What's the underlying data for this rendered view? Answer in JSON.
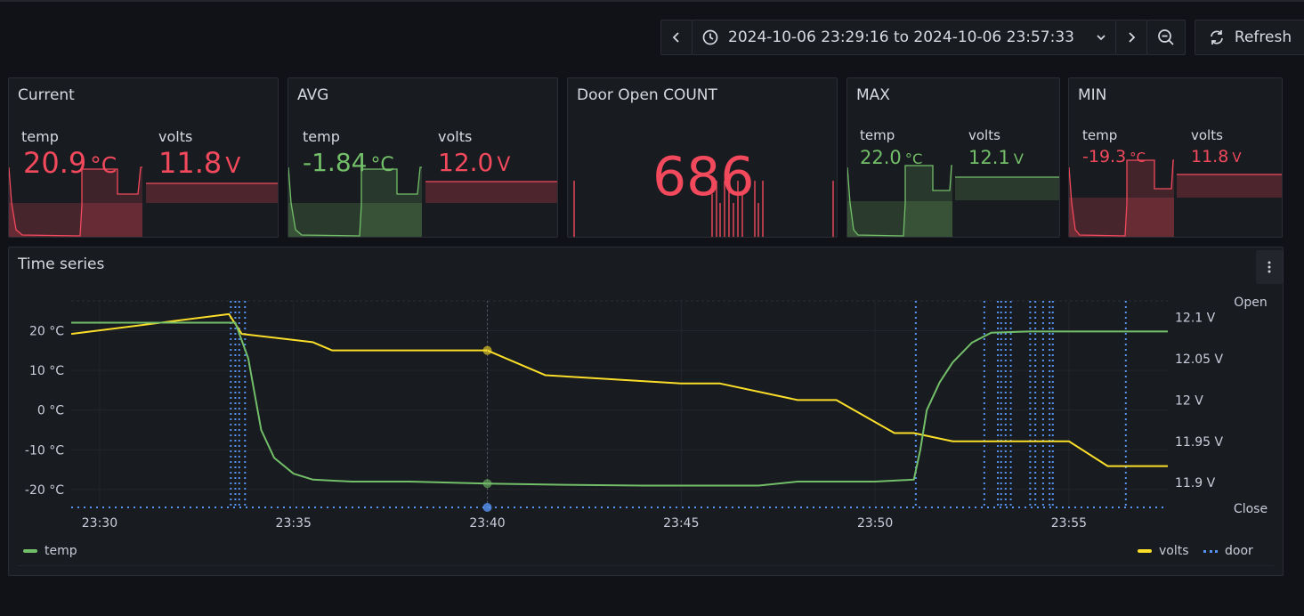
{
  "toolbar": {
    "time_range": "2024-10-06 23:29:16 to 2024-10-06 23:57:33",
    "refresh_label": "Refresh"
  },
  "stats": {
    "current": {
      "title": "Current",
      "temp_label": "temp",
      "temp_value": "20.9",
      "temp_unit": "°C",
      "volts_label": "volts",
      "volts_value": "11.8",
      "volts_unit": "V"
    },
    "avg": {
      "title": "AVG",
      "temp_label": "temp",
      "temp_value": "-1.84",
      "temp_unit": "°C",
      "volts_label": "volts",
      "volts_value": "12.0",
      "volts_unit": "V"
    },
    "door": {
      "title": "Door Open COUNT",
      "value": "686"
    },
    "max": {
      "title": "MAX",
      "temp_label": "temp",
      "temp_value": "22.0",
      "temp_unit": "°C",
      "volts_label": "volts",
      "volts_value": "12.1",
      "volts_unit": "V"
    },
    "min": {
      "title": "MIN",
      "temp_label": "temp",
      "temp_value": "-19.3",
      "temp_unit": "°C",
      "volts_label": "volts",
      "volts_value": "11.8",
      "volts_unit": "V"
    }
  },
  "colors": {
    "red": "#f2495c",
    "green": "#73bf69",
    "yellow": "#fade2a",
    "blue": "#5794f2"
  },
  "timeseries": {
    "title": "Time series",
    "legend": {
      "temp": "temp",
      "volts": "volts",
      "door": "door"
    }
  },
  "chart_data": {
    "type": "line",
    "title": "Time series",
    "x_ticks": [
      "23:30",
      "23:35",
      "23:40",
      "23:45",
      "23:50",
      "23:55"
    ],
    "xlim": [
      "23:29:16",
      "23:57:33"
    ],
    "y_left_ticks": [
      "20 °C",
      "10 °C",
      "0 °C",
      "-10 °C",
      "-20 °C"
    ],
    "y_left_range": [
      -24.5,
      27.5
    ],
    "y_right_ticks": [
      "12.1 V",
      "12.05 V",
      "12 V",
      "11.95 V",
      "11.9 V"
    ],
    "y_right_range": [
      11.87,
      12.12
    ],
    "door_labels": {
      "open": "Open",
      "close": "Close"
    },
    "series": [
      {
        "name": "temp",
        "axis": "left",
        "color": "#73bf69",
        "x": [
          "23:29:16",
          "23:33:30",
          "23:33:50",
          "23:34:10",
          "23:34:30",
          "23:35:00",
          "23:35:30",
          "23:36:30",
          "23:38:00",
          "23:40:00",
          "23:42:00",
          "23:44:00",
          "23:46:00",
          "23:47:00",
          "23:48:00",
          "23:49:00",
          "23:50:00",
          "23:51:00",
          "23:51:10",
          "23:51:20",
          "23:51:40",
          "23:52:00",
          "23:52:30",
          "23:53:00",
          "23:54:00",
          "23:55:00",
          "23:56:00",
          "23:57:33"
        ],
        "values": [
          22,
          22,
          13,
          -5,
          -12,
          -16,
          -17.5,
          -18,
          -18,
          -18.5,
          -18.8,
          -19,
          -19,
          -19,
          -18,
          -18,
          -18,
          -17.5,
          -10,
          0,
          7,
          12,
          17,
          19.5,
          19.8,
          19.8,
          19.8,
          19.8
        ]
      },
      {
        "name": "volts",
        "axis": "right",
        "color": "#fade2a",
        "x": [
          "23:29:16",
          "23:33:20",
          "23:33:40",
          "23:35:30",
          "23:36:00",
          "23:40:00",
          "23:41:30",
          "23:45:00",
          "23:46:00",
          "23:48:00",
          "23:49:00",
          "23:50:30",
          "23:51:00",
          "23:52:00",
          "23:53:00",
          "23:55:00",
          "23:56:00",
          "23:57:33"
        ],
        "values": [
          12.08,
          12.104,
          12.08,
          12.07,
          12.06,
          12.06,
          12.03,
          12.02,
          12.02,
          12.0,
          12.0,
          11.96,
          11.96,
          11.95,
          11.95,
          11.95,
          11.92,
          11.92
        ]
      },
      {
        "name": "door",
        "axis": "state",
        "color": "#5794f2",
        "open_times": [
          "23:33:23",
          "23:33:30",
          "23:33:36",
          "23:33:45",
          "23:51:03",
          "23:52:49",
          "23:53:10",
          "23:53:15",
          "23:53:22",
          "23:53:30",
          "23:54:00",
          "23:54:08",
          "23:54:20",
          "23:54:30",
          "23:54:35",
          "23:56:28"
        ]
      }
    ]
  }
}
